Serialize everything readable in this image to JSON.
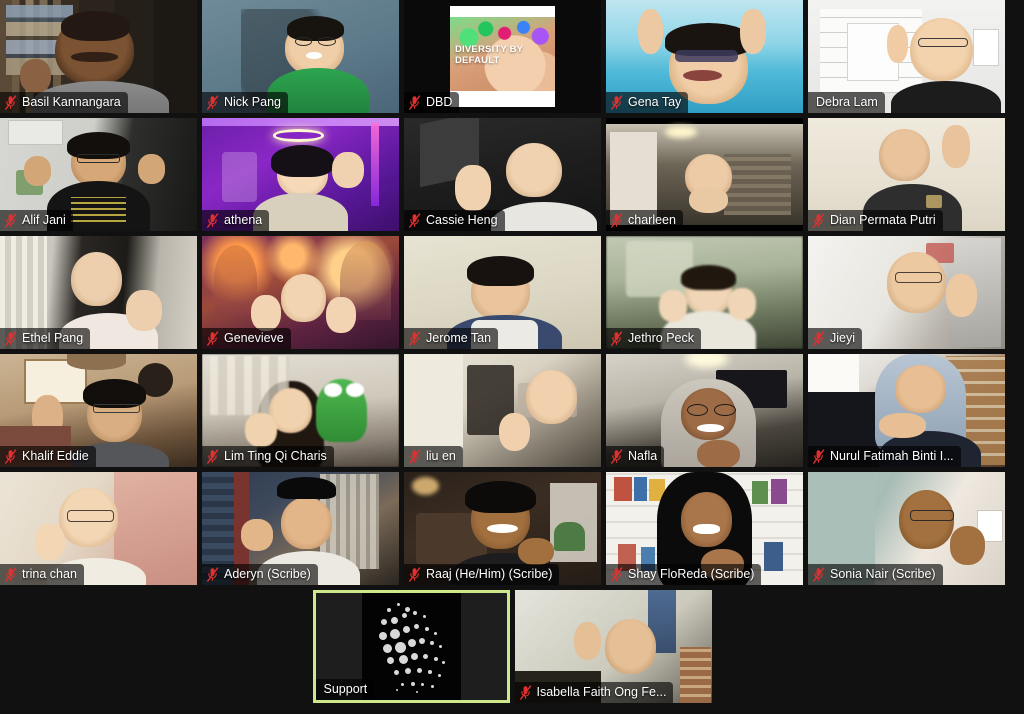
{
  "app": {
    "name": "Zoom Meeting",
    "view": "gallery-view",
    "background_color": "#111111",
    "tile_background_color": "#171717",
    "active_speaker_border_color": "#cfe98a",
    "muted_icon_color": "#e03030",
    "nameplate_text_color": "#ffffff",
    "participant_count": 27,
    "columns": 5,
    "rows": 6
  },
  "participants": [
    {
      "name": "Basil Kannangara",
      "muted": true,
      "speaking": false,
      "video": "on",
      "row": 1,
      "col": 1
    },
    {
      "name": "Nick Pang",
      "muted": true,
      "speaking": false,
      "video": "on",
      "row": 1,
      "col": 2
    },
    {
      "name": "DBD",
      "muted": true,
      "speaking": false,
      "video": "on",
      "row": 1,
      "col": 3,
      "content": "slide",
      "slide_text": "DIVERSITY BY DEFAULT"
    },
    {
      "name": "Gena Tay",
      "muted": true,
      "speaking": false,
      "video": "on",
      "row": 1,
      "col": 4
    },
    {
      "name": "Debra Lam",
      "muted": false,
      "speaking": false,
      "video": "on",
      "row": 1,
      "col": 5
    },
    {
      "name": "Alif Jani",
      "muted": true,
      "speaking": false,
      "video": "on",
      "row": 2,
      "col": 1
    },
    {
      "name": "athena",
      "muted": true,
      "speaking": false,
      "video": "on",
      "row": 2,
      "col": 2
    },
    {
      "name": "Cassie Heng",
      "muted": true,
      "speaking": false,
      "video": "on",
      "row": 2,
      "col": 3
    },
    {
      "name": "charleen",
      "muted": true,
      "speaking": false,
      "video": "on",
      "row": 2,
      "col": 4
    },
    {
      "name": "Dian Permata Putri",
      "muted": true,
      "speaking": false,
      "video": "on",
      "row": 2,
      "col": 5
    },
    {
      "name": "Ethel Pang",
      "muted": true,
      "speaking": false,
      "video": "on",
      "row": 3,
      "col": 1
    },
    {
      "name": "Genevieve",
      "muted": true,
      "speaking": false,
      "video": "on",
      "row": 3,
      "col": 2
    },
    {
      "name": "Jerome Tan",
      "muted": true,
      "speaking": false,
      "video": "on",
      "row": 3,
      "col": 3
    },
    {
      "name": "Jethro Peck",
      "muted": true,
      "speaking": false,
      "video": "on",
      "row": 3,
      "col": 4
    },
    {
      "name": "Jieyi",
      "muted": true,
      "speaking": false,
      "video": "on",
      "row": 3,
      "col": 5
    },
    {
      "name": "Khalif Eddie",
      "muted": true,
      "speaking": false,
      "video": "on",
      "row": 4,
      "col": 1
    },
    {
      "name": "Lim Ting Qi Charis",
      "muted": true,
      "speaking": false,
      "video": "on",
      "row": 4,
      "col": 2
    },
    {
      "name": "liu en",
      "muted": true,
      "speaking": false,
      "video": "on",
      "row": 4,
      "col": 3
    },
    {
      "name": "Nafla",
      "muted": true,
      "speaking": false,
      "video": "on",
      "row": 4,
      "col": 4
    },
    {
      "name": "Nurul Fatimah Binti I...",
      "muted": true,
      "speaking": false,
      "video": "on",
      "row": 4,
      "col": 5
    },
    {
      "name": "trina chan",
      "muted": true,
      "speaking": false,
      "video": "on",
      "row": 5,
      "col": 1
    },
    {
      "name": "Aderyn (Scribe)",
      "muted": true,
      "speaking": false,
      "video": "on",
      "row": 5,
      "col": 2
    },
    {
      "name": "Raaj (He/Him) (Scribe)",
      "muted": true,
      "speaking": false,
      "video": "on",
      "row": 5,
      "col": 3
    },
    {
      "name": "Shay FloReda (Scribe)",
      "muted": true,
      "speaking": false,
      "video": "on",
      "row": 5,
      "col": 4
    },
    {
      "name": "Sonia Nair (Scribe)",
      "muted": true,
      "speaking": false,
      "video": "on",
      "row": 5,
      "col": 5
    },
    {
      "name": "Support",
      "muted": false,
      "speaking": true,
      "video": "on",
      "row": 6,
      "col": 1
    },
    {
      "name": "Isabella Faith Ong Fe...",
      "muted": true,
      "speaking": false,
      "video": "on",
      "row": 6,
      "col": 2
    }
  ]
}
